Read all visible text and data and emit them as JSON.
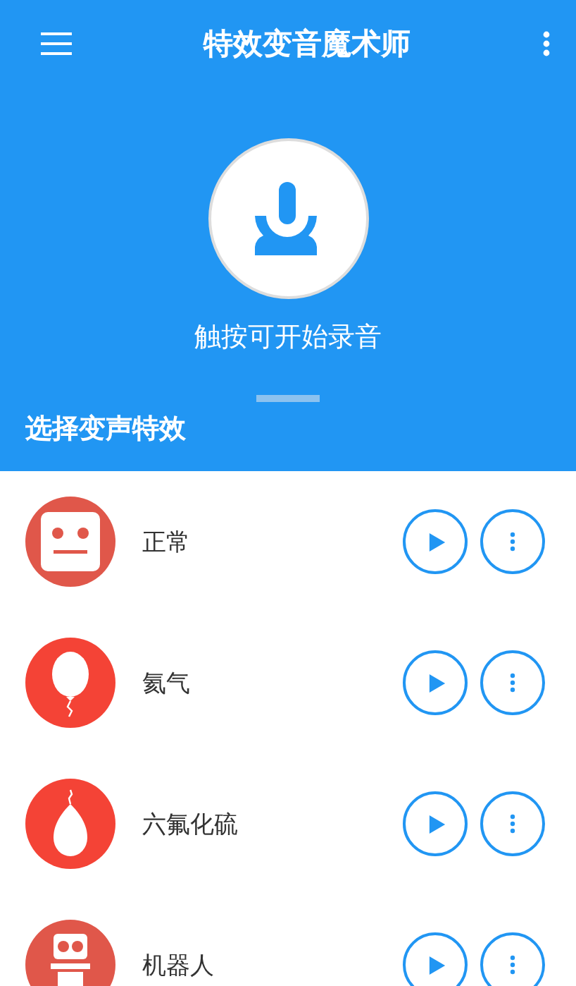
{
  "app_bar": {
    "title": "特效变音魔术师"
  },
  "record": {
    "hint": "触按可开始录音"
  },
  "section": {
    "title": "选择变声特效"
  },
  "effects": [
    {
      "name": "正常",
      "kind": "face"
    },
    {
      "name": "氦气",
      "kind": "balloon"
    },
    {
      "name": "六氟化硫",
      "kind": "drop"
    },
    {
      "name": "机器人",
      "kind": "robot"
    }
  ]
}
